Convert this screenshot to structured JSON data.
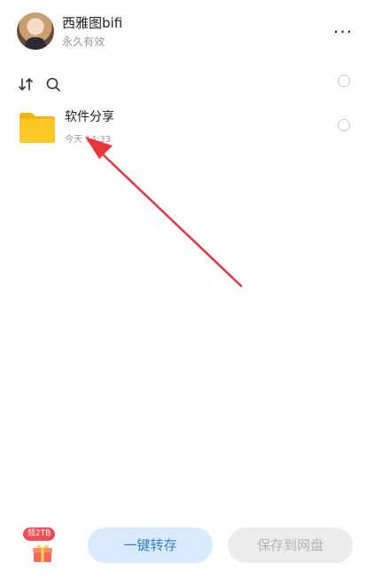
{
  "header": {
    "user_name": "西雅图bifi",
    "validity": "永久有效",
    "more_label": "···"
  },
  "toolbar": {
    "sort_icon": "sort-icon",
    "search_icon": "search-icon"
  },
  "files": [
    {
      "name": "软件分享",
      "time": "今天 14:33",
      "icon": "folder-icon"
    }
  ],
  "bottom": {
    "gift_badge": "领2TB",
    "save_one_click": "一键转存",
    "save_to_disk": "保存到网盘"
  },
  "colors": {
    "folder": "#f9c21e",
    "arrow": "#e8363c",
    "primary_text": "#2f7fd6",
    "primary_bg": "#d8eafc",
    "disabled_bg": "#ececec"
  }
}
